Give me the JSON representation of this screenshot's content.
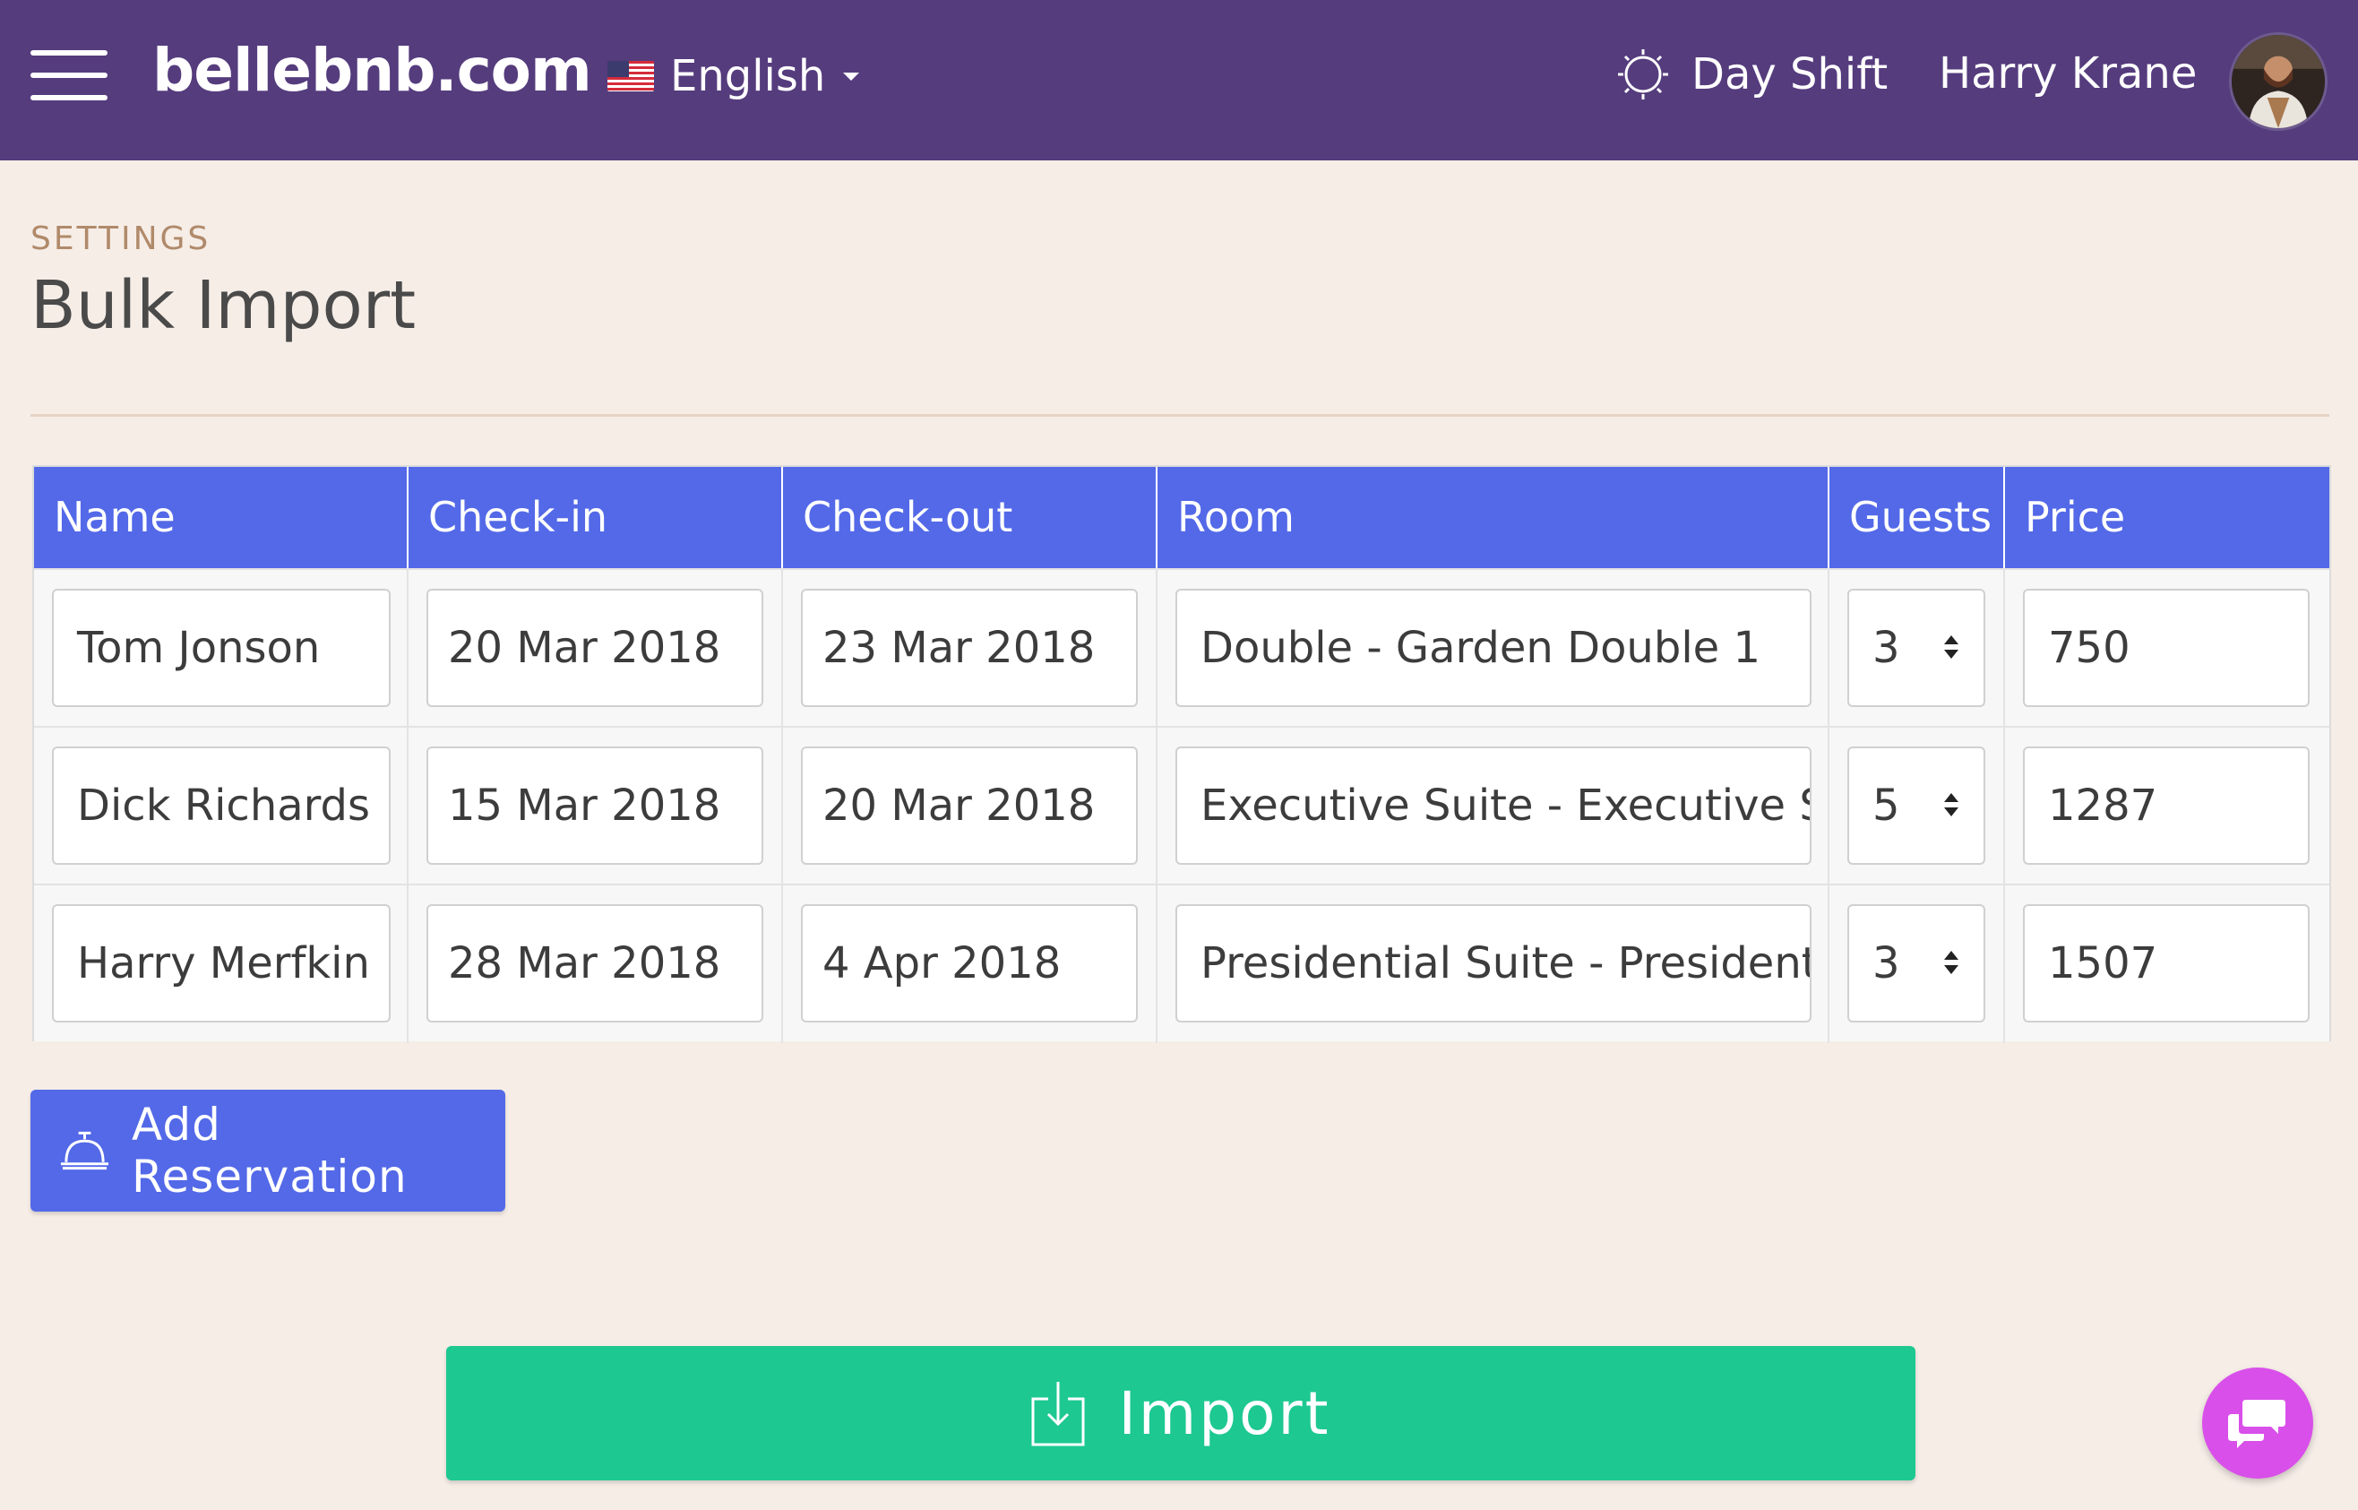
{
  "topbar": {
    "logo": "bellebnb.com",
    "language": "English",
    "shift": "Day Shift",
    "user_name": "Harry Krane",
    "color": "#553c7d"
  },
  "page": {
    "breadcrumb": "SETTINGS",
    "title": "Bulk Import"
  },
  "table": {
    "header_color": "#5369e8",
    "columns": [
      "Name",
      "Check-in",
      "Check-out",
      "Room",
      "Guests",
      "Price"
    ],
    "rows": [
      {
        "name": "Tom Jonson",
        "checkin": "20 Mar 2018",
        "checkout": "23 Mar 2018",
        "room": "Double - Garden Double 1",
        "guests": "3",
        "price": "750"
      },
      {
        "name": "Dick Richards",
        "checkin": "15 Mar 2018",
        "checkout": "20 Mar 2018",
        "room": "Executive Suite - Executive Suite",
        "guests": "5",
        "price": "1287"
      },
      {
        "name": "Harry Merfkin",
        "checkin": "28 Mar 2018",
        "checkout": "4 Apr 2018",
        "room": "Presidential Suite - Presidential",
        "guests": "3",
        "price": "1507"
      }
    ]
  },
  "actions": {
    "add_reservation": "Add Reservation",
    "import": "Import",
    "import_color": "#1dc891",
    "chat_color": "#d94fea"
  },
  "icons": {
    "menu": "hamburger-icon",
    "flag": "us-flag-icon",
    "shift": "sun-icon",
    "add": "service-bell-icon",
    "import": "download-tray-icon",
    "chat": "chat-bubbles-icon"
  }
}
